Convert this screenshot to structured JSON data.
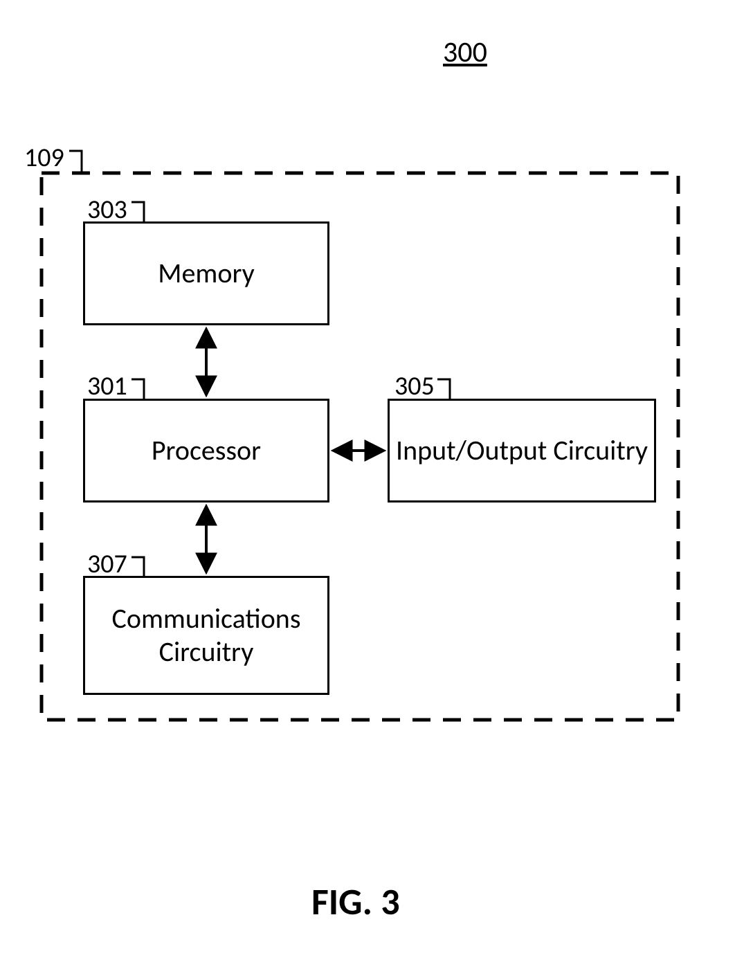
{
  "figure": {
    "number": "300",
    "caption": "FIG. 3"
  },
  "container": {
    "ref": "109"
  },
  "blocks": {
    "memory": {
      "ref": "303",
      "label": "Memory"
    },
    "processor": {
      "ref": "301",
      "label": "Processor"
    },
    "io": {
      "ref": "305",
      "label": "Input/Output Circuitry"
    },
    "comm": {
      "ref": "307",
      "label": "Communications\nCircuitry"
    }
  }
}
